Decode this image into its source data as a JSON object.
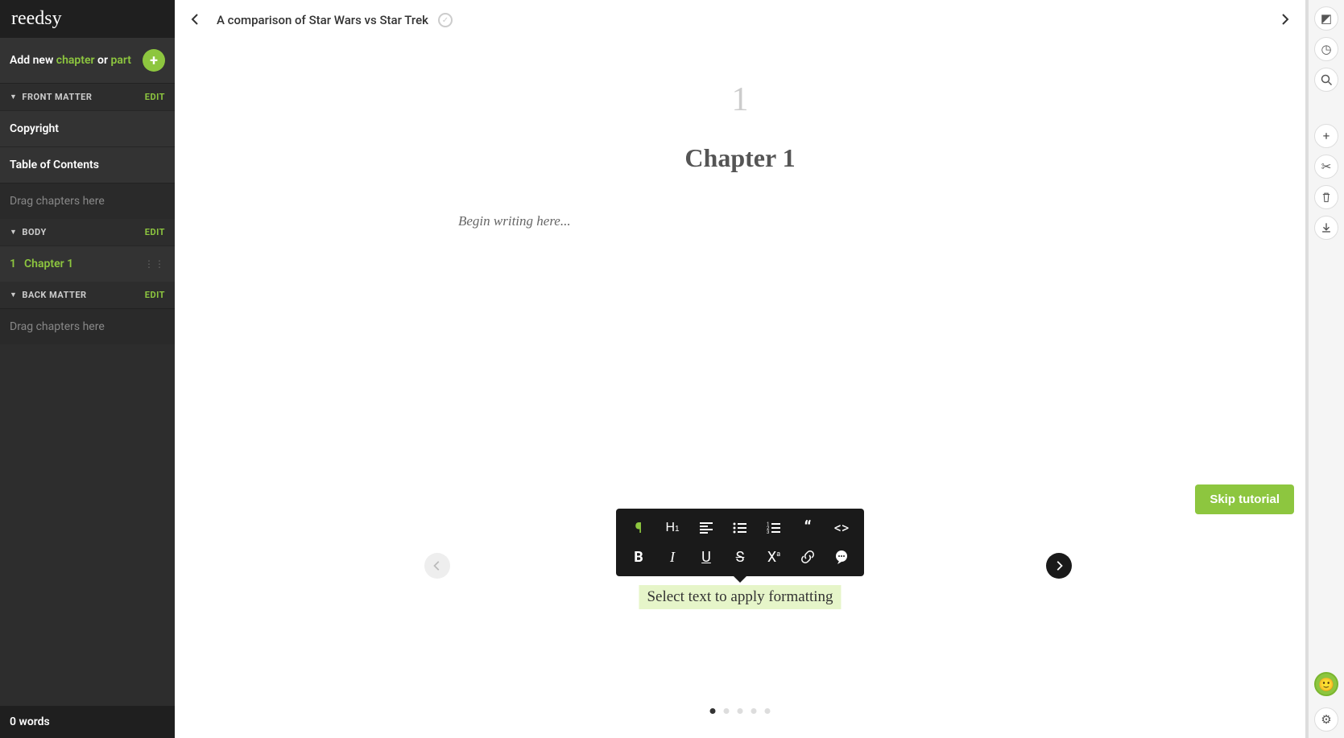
{
  "brand": "reedsy",
  "sidebar": {
    "add_new_prefix": "Add new ",
    "add_new_chapter": "chapter",
    "add_new_or": " or ",
    "add_new_part": "part",
    "sections": {
      "front_matter": {
        "title": "FRONT MATTER",
        "edit": "EDIT"
      },
      "body": {
        "title": "BODY",
        "edit": "EDIT"
      },
      "back_matter": {
        "title": "BACK MATTER",
        "edit": "EDIT"
      }
    },
    "front_items": [
      "Copyright",
      "Table of Contents"
    ],
    "drag_hint": "Drag chapters here",
    "body_items": [
      {
        "num": "1",
        "label": "Chapter 1",
        "active": true
      }
    ],
    "word_count": "0 words"
  },
  "topbar": {
    "title": "A comparison of Star Wars vs Star Trek"
  },
  "editor": {
    "chapter_number": "1",
    "chapter_title": "Chapter 1",
    "placeholder": "Begin writing here..."
  },
  "tutorial": {
    "skip_label": "Skip tutorial",
    "hint": "Select text to apply formatting",
    "step": 1,
    "total_steps": 5
  },
  "right_toolbar": {
    "icons": [
      "goals",
      "history",
      "search",
      "add",
      "shuffle",
      "delete",
      "download"
    ]
  },
  "colors": {
    "accent": "#8dc63f",
    "sidebar_bg": "#2d2d2d",
    "toolbar_bg": "#1a1a1a"
  }
}
